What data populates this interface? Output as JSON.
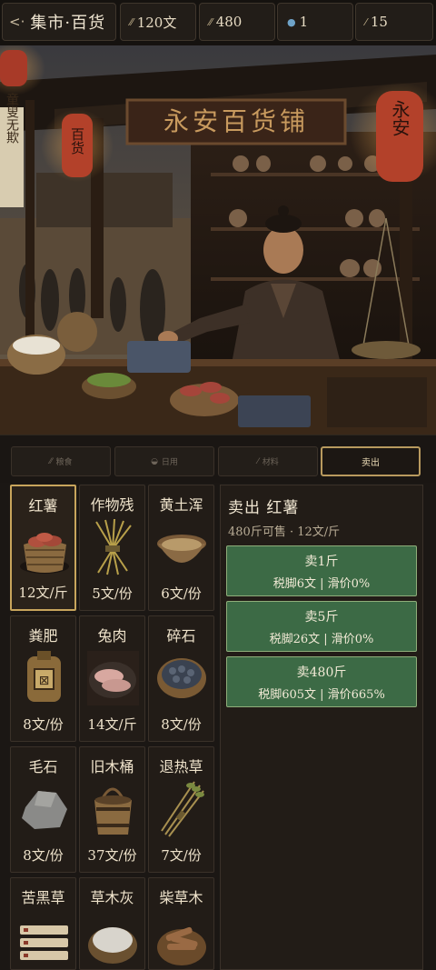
{
  "header": {
    "back_glyph": "<·",
    "title": "集市·百货",
    "stats": [
      {
        "icon": "coin-icon",
        "value": "120文"
      },
      {
        "icon": "grain-icon",
        "value": "480"
      },
      {
        "icon": "water-drop-icon",
        "value": "1"
      },
      {
        "icon": "feather-icon",
        "value": "15"
      }
    ]
  },
  "scene": {
    "shop_sign": "永安百货铺",
    "lantern_left": "百货",
    "lantern_right": "永安",
    "banner": "童叟无欺"
  },
  "tabs": [
    {
      "label": "粮食",
      "icon": "grain-icon",
      "active": false
    },
    {
      "label": "日用",
      "icon": "bowl-icon",
      "active": false
    },
    {
      "label": "材料",
      "icon": "tool-icon",
      "active": false
    },
    {
      "label": "卖出",
      "icon": "",
      "active": true
    }
  ],
  "items": [
    {
      "name": "红薯",
      "price": "12文/斤",
      "icon": "sweet-potato-basket-icon",
      "selected": true
    },
    {
      "name": "作物残",
      "price": "5文/份",
      "icon": "straw-bundle-icon",
      "selected": false
    },
    {
      "name": "黄土浑",
      "price": "6文/份",
      "icon": "mud-bowl-icon",
      "selected": false
    },
    {
      "name": "粪肥",
      "price": "8文/份",
      "icon": "fertilizer-sack-icon",
      "selected": false
    },
    {
      "name": "兔肉",
      "price": "14文/斤",
      "icon": "rabbit-meat-icon",
      "selected": false
    },
    {
      "name": "碎石",
      "price": "8文/份",
      "icon": "gravel-basket-icon",
      "selected": false
    },
    {
      "name": "毛石",
      "price": "8文/份",
      "icon": "rough-stone-icon",
      "selected": false
    },
    {
      "name": "旧木桶",
      "price": "37文/份",
      "icon": "wooden-bucket-icon",
      "selected": false
    },
    {
      "name": "退热草",
      "price": "7文/份",
      "icon": "herb-bundle-icon",
      "selected": false
    },
    {
      "name": "苦黑草",
      "price": "",
      "icon": "bitter-herb-tags-icon",
      "selected": false
    },
    {
      "name": "草木灰",
      "price": "",
      "icon": "ash-bowl-icon",
      "selected": false
    },
    {
      "name": "柴草木",
      "price": "",
      "icon": "firewood-bowl-icon",
      "selected": false
    }
  ],
  "sell_panel": {
    "title": "卖出 红薯",
    "subtitle": "480斤可售 · 12文/斤",
    "buttons": [
      {
        "label": "卖1斤",
        "detail": "税脚6文 | 滑价0%"
      },
      {
        "label": "卖5斤",
        "detail": "税脚26文 | 滑价0%"
      },
      {
        "label": "卖480斤",
        "detail": "税脚605文 | 滑价665%"
      }
    ]
  },
  "colors": {
    "background": "#1b1714",
    "accent_gold": "#c8a55c",
    "sell_green": "#3c6a45"
  }
}
